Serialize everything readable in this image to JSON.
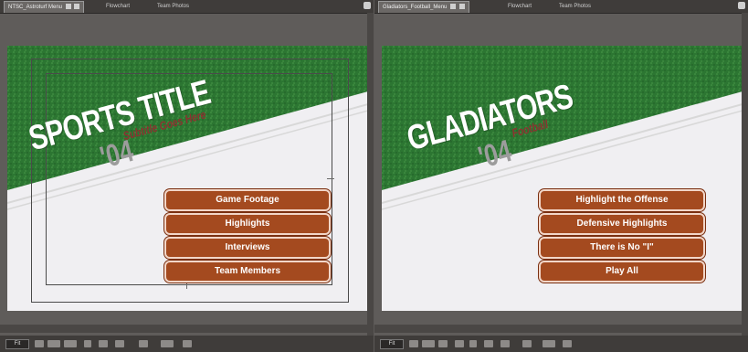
{
  "left_panel": {
    "tabs": [
      {
        "label": "NTSC_Astroturf Menu"
      },
      {
        "label": "Flowchart"
      },
      {
        "label": "Team Photos"
      }
    ],
    "title_main": "SPORTS TITLE",
    "subtitle": "Subtitle Goes Here",
    "year": "'04",
    "buttons": [
      "Game Footage",
      "Highlights",
      "Interviews",
      "Team Members"
    ],
    "zoom": "Fit"
  },
  "right_panel": {
    "tabs": [
      {
        "label": "Gladiators_Football_Menu"
      },
      {
        "label": "Flowchart"
      },
      {
        "label": "Team Photos"
      }
    ],
    "title_main": "GLADIATORS",
    "subtitle": "Football",
    "year": "'04",
    "buttons": [
      "Highlight the Offense",
      "Defensive Highlights",
      "There is No \"I\"",
      "Play All"
    ],
    "zoom": "Fit"
  },
  "colors": {
    "turf": "#2f7a35",
    "button_fill": "#a44a1f",
    "button_border": "#f2d6c8",
    "subtitle": "#8a3330",
    "year": "#9c9c9c",
    "canvas_bg": "#f0eff2"
  },
  "icons": [
    "panel-menu-icon",
    "tab-close-icon",
    "tab-menu-icon"
  ]
}
